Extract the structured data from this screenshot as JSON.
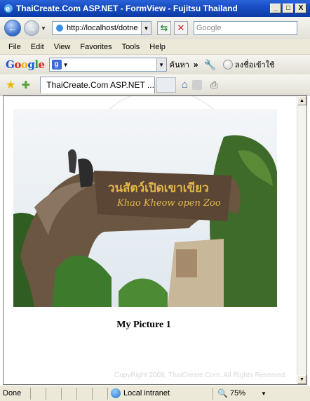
{
  "window": {
    "title": "ThaiCreate.Com ASP.NET - FormView - Fujitsu Thailand",
    "minimize": "_",
    "maximize": "□",
    "close": "X"
  },
  "address_bar": {
    "url": "http://localhost/dotne",
    "search_placeholder": "Google"
  },
  "menu": [
    "File",
    "Edit",
    "View",
    "Favorites",
    "Tools",
    "Help"
  ],
  "google_toolbar": {
    "logo": "Google",
    "search_text": "ค้นหา",
    "sign_in": "ลงชื่อเข้าใช้"
  },
  "tab": {
    "title": "ThaiCreate.Com ASP.NET ..."
  },
  "content": {
    "photo": {
      "sign_thai": "วนสัตว์เปิดเขาเขียว",
      "sign_english": "Khao Kheow open Zoo"
    },
    "caption": "My Picture 1",
    "watermark": "CopyRight 2009, ThaiCreate.Com. All Rights Reserved."
  },
  "status_bar": {
    "status": "Done",
    "zone": "Local intranet",
    "zoom": "75%"
  },
  "colors": {
    "titlebar": "#0c3aa5",
    "chrome": "#ece9d8"
  }
}
